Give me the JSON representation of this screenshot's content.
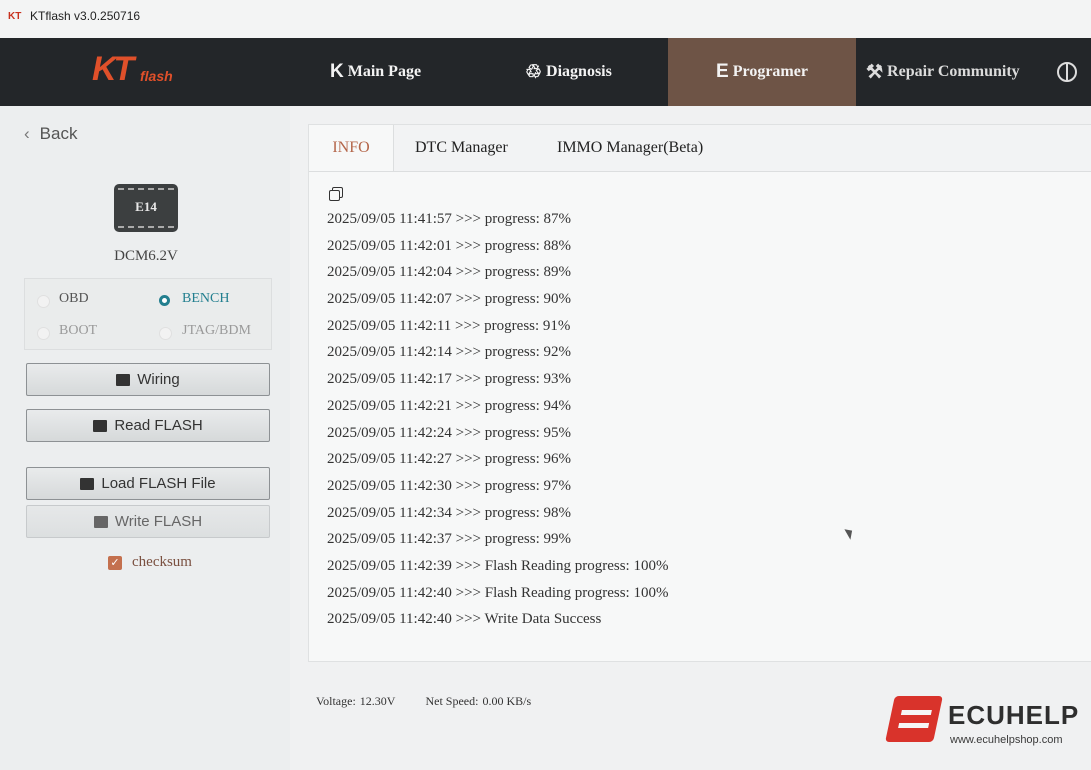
{
  "window": {
    "title": "KTflash v3.0.250716",
    "logo_text": "KT"
  },
  "brand": {
    "logo_main": "KT",
    "logo_sub": "flash"
  },
  "nav": [
    {
      "icon": "K",
      "label": "Main Page"
    },
    {
      "icon": "♲",
      "label": "Diagnosis"
    },
    {
      "icon": "E",
      "label": "Programer"
    },
    {
      "icon": "⚒",
      "label": "Repair Community"
    }
  ],
  "sidebar": {
    "back_label": "Back",
    "chip_label": "E14",
    "ecu_name": "DCM6.2V",
    "modes": {
      "obd": "OBD",
      "bench": "BENCH",
      "boot": "BOOT",
      "jtag": "JTAG/BDM"
    },
    "buttons": {
      "wiring": "Wiring",
      "read_flash": "Read FLASH",
      "load_flash": "Load FLASH File",
      "write_flash": "Write FLASH"
    },
    "checksum_label": "checksum"
  },
  "tabs": {
    "info": "INFO",
    "dtc": "DTC Manager",
    "immo": "IMMO Manager(Beta)"
  },
  "log": [
    "2025/09/05 11:41:57 >>> progress: 87%",
    "2025/09/05 11:42:01 >>> progress: 88%",
    "2025/09/05 11:42:04 >>> progress: 89%",
    "2025/09/05 11:42:07 >>> progress: 90%",
    "2025/09/05 11:42:11 >>> progress: 91%",
    "2025/09/05 11:42:14 >>> progress: 92%",
    "2025/09/05 11:42:17 >>> progress: 93%",
    "2025/09/05 11:42:21 >>> progress: 94%",
    "2025/09/05 11:42:24 >>> progress: 95%",
    "2025/09/05 11:42:27 >>> progress: 96%",
    "2025/09/05 11:42:30 >>> progress: 97%",
    "2025/09/05 11:42:34 >>> progress: 98%",
    "2025/09/05 11:42:37 >>> progress: 99%",
    "2025/09/05 11:42:39 >>> Flash Reading progress: 100%",
    "2025/09/05 11:42:40 >>> Flash Reading progress: 100%",
    "2025/09/05 11:42:40 >>> Write Data Success"
  ],
  "status": {
    "voltage_label": "Voltage:",
    "voltage_value": "12.30V",
    "speed_label": "Net Speed:",
    "speed_value": "0.00 KB/s"
  },
  "watermark": {
    "brand": "ECUHELP",
    "url": "www.ecuhelpshop.com"
  },
  "colors": {
    "accent": "#b4664a",
    "teal": "#237f8f",
    "nav_bg": "#232629",
    "nav_active": "#6e5446"
  }
}
